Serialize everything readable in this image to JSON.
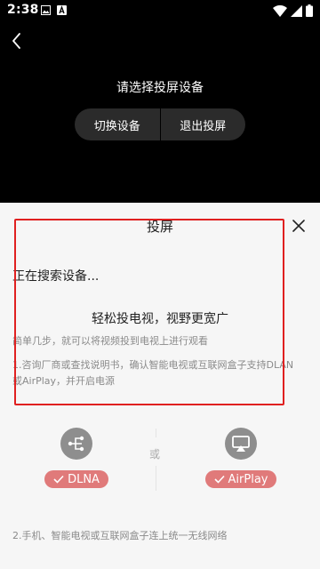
{
  "status_bar": {
    "time": "2:38",
    "icons": [
      "image-icon",
      "a-icon",
      "wifi-icon",
      "signal-icon",
      "battery-icon"
    ]
  },
  "player": {
    "select_title": "请选择投屏设备",
    "switch_device": "切换设备",
    "exit_cast": "退出投屏"
  },
  "sheet": {
    "title": "投屏",
    "searching": "正在搜索设备...",
    "slogan": "轻松投电视，视野更宽广",
    "tip_simple": "简单几步，就可以将视频投到电视上进行观看",
    "tip_step1": "1.咨询厂商或查找说明书，确认智能电视或互联网盒子支持DLAN或AirPlay，并开启电源",
    "or": "或",
    "dlna_label": "DLNA",
    "airplay_label": "AirPlay",
    "tip_step2": "2.手机、智能电视或互联网盒子连上统一无线网络"
  },
  "colors": {
    "highlight": "#e02020",
    "tag_bg": "#e07a7a",
    "icon_circle": "#8e8e8e"
  }
}
